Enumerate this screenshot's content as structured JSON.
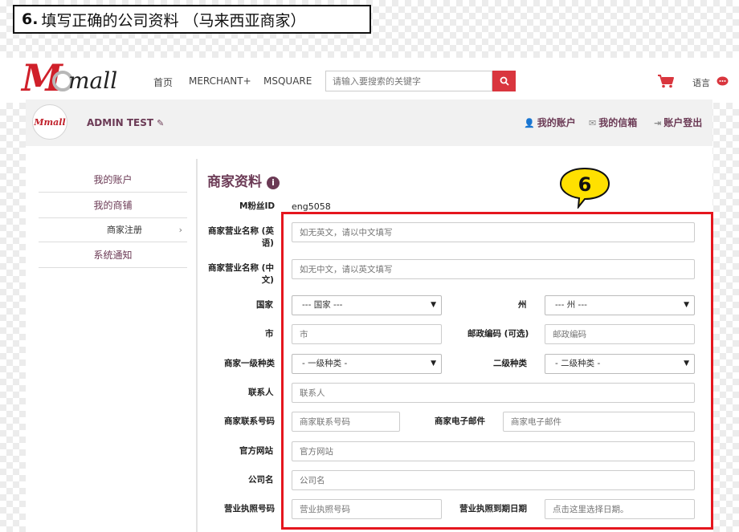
{
  "step_banner": {
    "number": "6.",
    "text": "填写正确的公司资料 （马来西亚商家）"
  },
  "navbar": {
    "nav": [
      "首页",
      "MERCHANT+",
      "MSQUARE"
    ],
    "search_placeholder": "请输入要搜索的关键字",
    "language": "语言"
  },
  "admin": {
    "name": "ADMIN TEST",
    "links": [
      "我的账户",
      "我的信箱",
      "账户登出"
    ]
  },
  "sidebar": {
    "items": [
      "我的账户",
      "我的商铺"
    ],
    "sub_item": "商家注册",
    "notice": "系统通知"
  },
  "form": {
    "title": "商家资料",
    "fan_id_label": "M粉丝ID",
    "fan_id_value": "eng5058",
    "name_en_label": "商家营业名称 (英语)",
    "name_en_placeholder": "如无英文，请以中文填写",
    "name_cn_label": "商家营业名称 (中文)",
    "name_cn_placeholder": "如无中文，请以英文填写",
    "country_label": "国家",
    "country_value": "--- 国家 ---",
    "state_label": "州",
    "state_value": "--- 州 ---",
    "city_label": "市",
    "city_placeholder": "市",
    "postcode_label": "邮政编码 (可选)",
    "postcode_placeholder": "邮政编码",
    "cat1_label": "商家一级种类",
    "cat1_value": "- 一级种类 -",
    "cat2_label": "二级种类",
    "cat2_value": "- 二级种类 -",
    "contact_label": "联系人",
    "contact_placeholder": "联系人",
    "phone_label": "商家联系号码",
    "phone_placeholder": "商家联系号码",
    "email_label": "商家电子邮件",
    "email_placeholder": "商家电子邮件",
    "website_label": "官方网站",
    "website_placeholder": "官方网站",
    "company_label": "公司名",
    "company_placeholder": "公司名",
    "license_label": "营业执照号码",
    "license_placeholder": "营业执照号码",
    "license_expiry_label": "营业执照到期日期",
    "license_expiry_placeholder": "点击这里选择日期。"
  },
  "callout_number": "6",
  "colors": {
    "brand_red": "#d9363e",
    "highlight_red": "#e5161e",
    "accent_purple": "#6b3a55",
    "callout_yellow": "#ffe000"
  }
}
